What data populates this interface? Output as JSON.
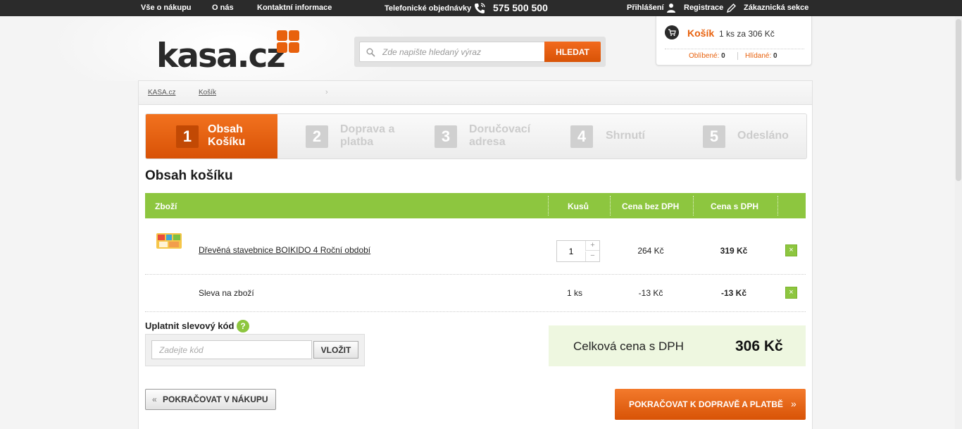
{
  "topbar": {
    "nav": [
      "Vše o nákupu",
      "O nás",
      "Kontaktní informace"
    ],
    "phone_label": "Telefonické objednávky",
    "phone_number": "575 500 500",
    "login": "Přihlášení",
    "register": "Registrace",
    "customer": "Zákaznická sekce"
  },
  "header": {
    "logo": "kasa.cz",
    "search_placeholder": "Zde napište hledaný výraz",
    "search_button": "HLEDAT"
  },
  "cart": {
    "title": "Košík",
    "summary": "1 ks za 306 Kč",
    "favorites_label": "Oblíbené:",
    "favorites_count": "0",
    "watched_label": "Hlídané:",
    "watched_count": "0"
  },
  "breadcrumb": [
    "KASA.cz",
    "Košík"
  ],
  "steps": [
    {
      "num": "1",
      "label": "Obsah Košíku"
    },
    {
      "num": "2",
      "label": "Doprava a platba"
    },
    {
      "num": "3",
      "label": "Doručovací adresa"
    },
    {
      "num": "4",
      "label": "Shrnutí"
    },
    {
      "num": "5",
      "label": "Odesláno"
    }
  ],
  "page_title": "Obsah košíku",
  "table": {
    "headers": [
      "Zboží",
      "Kusů",
      "Cena bez DPH",
      "Cena s DPH"
    ],
    "rows": [
      {
        "name": "Dřevěná stavebnice BOIKIDO 4 Roční období",
        "qty": "1",
        "price_ex": "264 Kč",
        "price_inc": "319 Kč"
      },
      {
        "name": "Sleva na zboží",
        "qty": "1 ks",
        "price_ex": "-13 Kč",
        "price_inc": "-13 Kč"
      }
    ]
  },
  "coupon": {
    "title": "Uplatnit slevový kód",
    "help": "?",
    "placeholder": "Zadejte kód",
    "button": "VLOŽIT"
  },
  "total": {
    "label": "Celková cena s DPH",
    "value": "306 Kč"
  },
  "buttons": {
    "back": "POKRAČOVAT V NÁKUPU",
    "back_arrow": "«",
    "next": "POKRAČOVAT K DOPRAVĚ A PLATBĚ",
    "next_arrow": "»"
  },
  "icons": {
    "plus": "+",
    "minus": "−",
    "delete": "×",
    "chevron": "›"
  },
  "colors": {
    "accent": "#e8610d",
    "green": "#8dc63f",
    "dark": "#2b2b2b"
  }
}
